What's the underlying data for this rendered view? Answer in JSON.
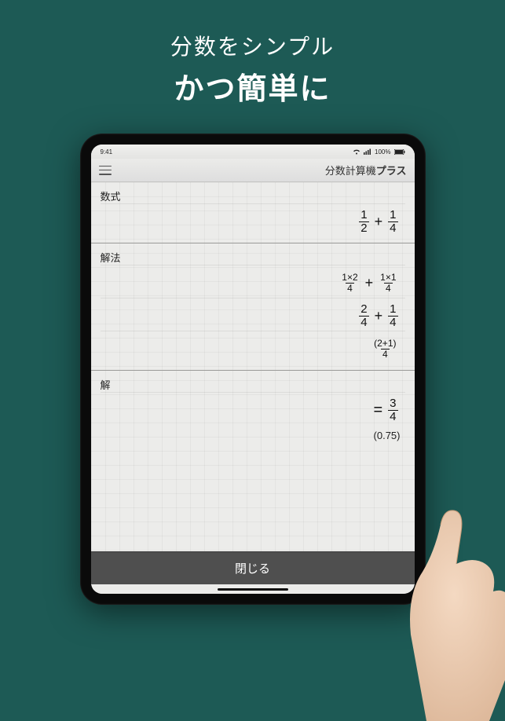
{
  "hero": {
    "line1": "分数をシンプル",
    "line2": "かつ簡単に"
  },
  "statusbar": {
    "time": "9:41",
    "battery": "100%"
  },
  "titlebar": {
    "app_name_prefix": "分数計算機",
    "app_name_bold": "プラス"
  },
  "sections": {
    "expression_label": "数式",
    "solution_label": "解法",
    "answer_label": "解"
  },
  "expression": {
    "f1": {
      "n": "1",
      "d": "2"
    },
    "op": "+",
    "f2": {
      "n": "1",
      "d": "4"
    }
  },
  "solution_steps": [
    {
      "f1": {
        "n": "1×2",
        "d": "4"
      },
      "op": "+",
      "f2": {
        "n": "1×1",
        "d": "4"
      }
    },
    {
      "f1": {
        "n": "2",
        "d": "4"
      },
      "op": "+",
      "f2": {
        "n": "1",
        "d": "4"
      }
    },
    {
      "single": {
        "n": "(2+1)",
        "d": "4"
      }
    }
  ],
  "answer": {
    "eq": "=",
    "frac": {
      "n": "3",
      "d": "4"
    },
    "decimal": "(0.75)"
  },
  "close_button": "閉じる"
}
